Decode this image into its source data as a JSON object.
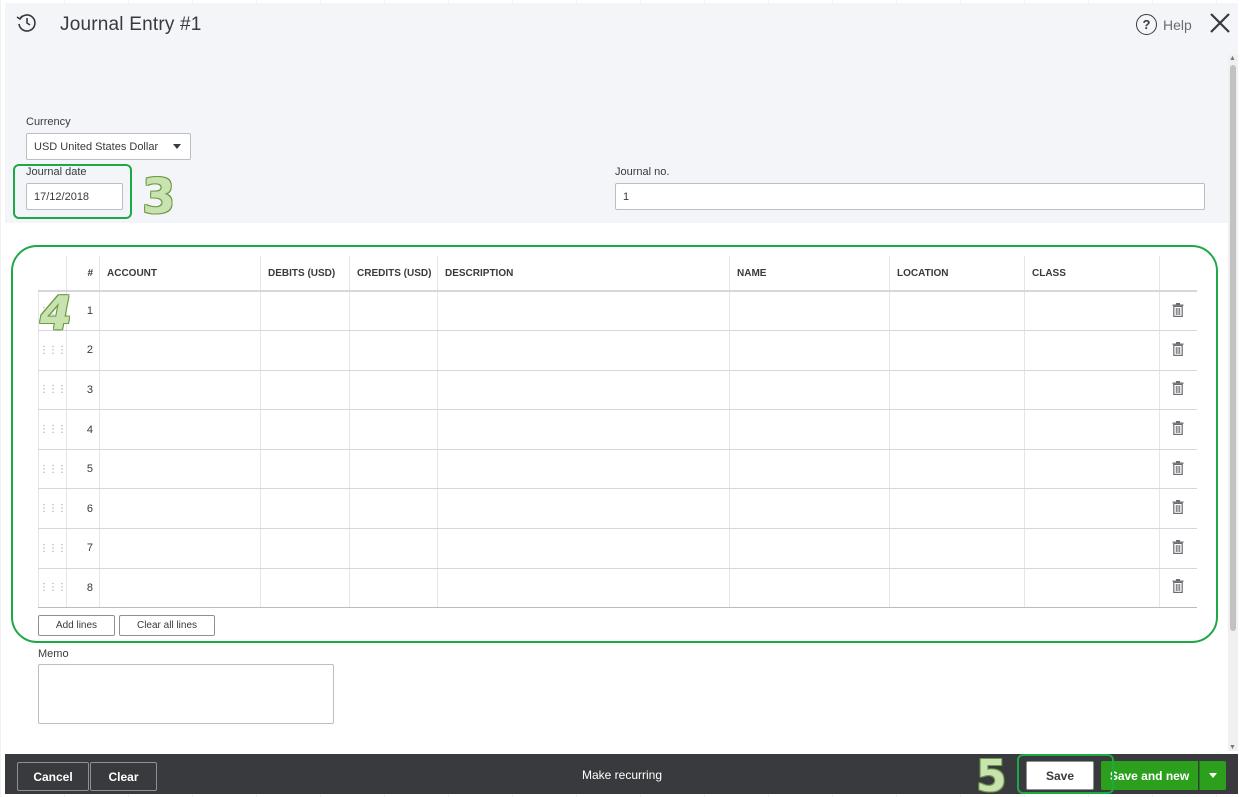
{
  "window": {
    "title": "Journal Entry #1",
    "help_label": "Help"
  },
  "form": {
    "currency_label": "Currency",
    "currency_value": "USD United States Dollar",
    "journal_date_label": "Journal date",
    "journal_date_value": "17/12/2018",
    "journal_no_label": "Journal no.",
    "journal_no_value": "1"
  },
  "table": {
    "headers": [
      "#",
      "ACCOUNT",
      "DEBITS (USD)",
      "CREDITS (USD)",
      "DESCRIPTION",
      "NAME",
      "LOCATION",
      "CLASS"
    ],
    "row_numbers": [
      "1",
      "2",
      "3",
      "4",
      "5",
      "6",
      "7",
      "8"
    ]
  },
  "buttons": {
    "add_lines": "Add lines",
    "clear_all_lines": "Clear all lines"
  },
  "memo": {
    "label": "Memo"
  },
  "footer": {
    "cancel": "Cancel",
    "clear": "Clear",
    "make_recurring": "Make recurring",
    "save": "Save",
    "save_and_new": "Save and new"
  },
  "annotations": {
    "step_3": "3",
    "step_4": "4",
    "step_5": "5"
  },
  "colors": {
    "accent_green": "#2ca01c",
    "highlight_green": "#1fa846",
    "footer_bg": "#393a3d"
  }
}
